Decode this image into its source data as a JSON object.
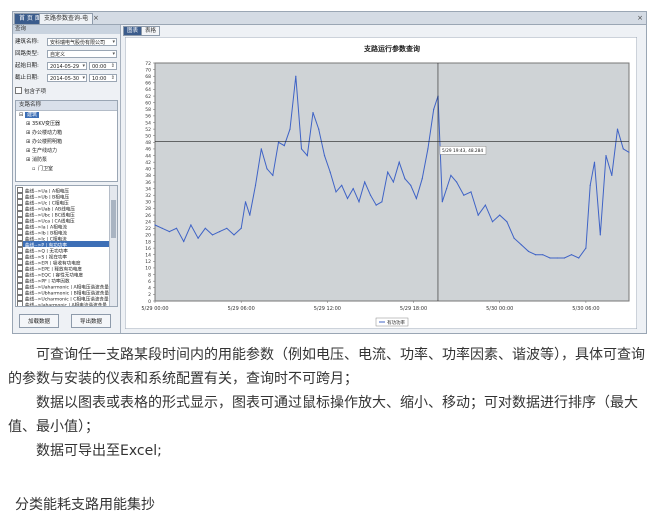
{
  "window": {
    "tabs": [
      {
        "label": "首 页 面"
      },
      {
        "label": "支路参数查询-电"
      }
    ],
    "close_glyph": "×"
  },
  "filters": {
    "panel_title": "查询",
    "meter_label": "建筑名称:",
    "meter_value": "安科瑞电气股份有限公司",
    "group_label": "回路类型:",
    "group_value": "自定义",
    "start_label": "起始日期:",
    "start_date": "2014-05-29",
    "start_time": "00:00",
    "end_label": "截止日期:",
    "end_date": "2014-05-30",
    "end_time": "10:00",
    "checkbox_label": "包含子项"
  },
  "tree": {
    "header": "支路名称",
    "nodes": [
      {
        "label": "建筑",
        "selected": true
      },
      {
        "label": "35KV变压器"
      },
      {
        "label": "办公楼动力箱"
      },
      {
        "label": "办公楼照明箱"
      },
      {
        "label": "生产线动力"
      },
      {
        "label": "消防泵"
      },
      {
        "label": "门卫室"
      }
    ]
  },
  "params": [
    "曲线-->Ua | A相电压",
    "曲线-->Ub | B相电压",
    "曲线-->Uc | C相电压",
    "曲线-->Uab | AB线电压",
    "曲线-->Ubc | BC线电压",
    "曲线-->Uca | CA线电压",
    "曲线-->Ia | A相电流",
    "曲线-->Ib | B相电流",
    "曲线-->Ic | C相电流",
    "曲线-->P | 有功功率",
    "曲线-->Q | 无功功率",
    "曲线-->S | 视在功率",
    "曲线-->EPI | 吸收有功电度",
    "曲线-->EPE | 释放有功电度",
    "曲线-->EQC | 容性无功电度",
    "曲线-->PF | 功率因数",
    "曲线-->Uaharmonic | A相电压谐波含量",
    "曲线-->Ubharmonic | B相电压谐波含量",
    "曲线-->Ucharmonic | C相电压谐波含量",
    "曲线-->Iaharmonic | A相电流谐波含量"
  ],
  "buttons": {
    "query": "加载数据",
    "export": "导出数据"
  },
  "view_tabs": [
    {
      "label": "图表"
    },
    {
      "label": "表格"
    }
  ],
  "chart_data": {
    "type": "line",
    "title": "支路运行参数查询",
    "ylim": [
      0,
      72
    ],
    "yticks": [
      0,
      2,
      4,
      6,
      8,
      10,
      12,
      14,
      16,
      18,
      20,
      22,
      24,
      26,
      28,
      30,
      32,
      34,
      36,
      38,
      40,
      42,
      44,
      46,
      48,
      50,
      52,
      54,
      56,
      58,
      60,
      62,
      64,
      66,
      68,
      70,
      72
    ],
    "xticks": [
      "5/29 00:00",
      "5/29 06:00",
      "5/29 12:00",
      "5/29 18:00",
      "5/30 00:00",
      "5/30 06:00"
    ],
    "x_hours_range": [
      0,
      33
    ],
    "crosshair_label": "5/29 19:43, 48.284",
    "legend": "有功功率",
    "series": [
      {
        "name": "有功功率",
        "color": "#3f63c6",
        "x": [
          0,
          0.5,
          1,
          1.5,
          2,
          2.5,
          3,
          3.5,
          4,
          4.5,
          5,
          5.5,
          6,
          6.3,
          6.6,
          7,
          7.4,
          7.8,
          8.2,
          8.6,
          9,
          9.4,
          9.8,
          10.2,
          10.6,
          11,
          11.4,
          11.8,
          12.2,
          12.6,
          13,
          13.4,
          13.8,
          14.2,
          14.6,
          15,
          15.4,
          15.8,
          16.2,
          16.6,
          17,
          17.4,
          17.8,
          18.2,
          18.6,
          19,
          19.4,
          19.7,
          20,
          20.3,
          20.6,
          21,
          21.5,
          22,
          22.5,
          23,
          23.5,
          24,
          24.5,
          25,
          25.5,
          26,
          26.5,
          27,
          27.5,
          28,
          28.5,
          29,
          29.5,
          30,
          30.3,
          30.6,
          31,
          31.4,
          31.8,
          32.2,
          32.6,
          33
        ],
        "values": [
          23,
          22,
          21,
          22,
          18,
          23,
          19,
          22,
          20,
          21,
          22,
          20,
          22,
          30,
          26,
          35,
          46,
          40,
          38,
          48,
          47,
          52,
          68,
          46,
          44,
          57,
          52,
          44,
          39,
          33,
          35,
          31,
          34,
          30,
          36,
          32,
          29,
          30,
          39,
          36,
          42,
          37,
          35,
          31,
          37,
          46,
          58,
          62,
          30,
          34,
          38,
          36,
          32,
          33,
          26,
          29,
          24,
          26,
          24,
          19,
          17,
          15,
          14,
          14,
          13,
          13,
          13,
          14,
          13,
          16,
          35,
          42,
          20,
          44,
          38,
          52,
          46,
          45
        ]
      }
    ]
  }
}
